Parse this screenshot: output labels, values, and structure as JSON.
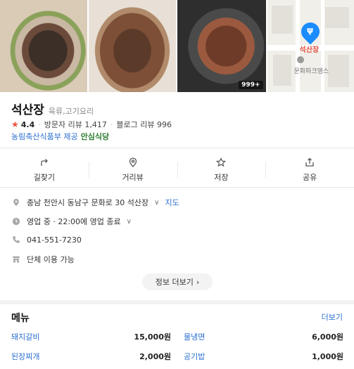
{
  "photos": {
    "count_badge": "999+",
    "map": {
      "pin_label": "석산장",
      "poi_label": "문화파크엠스"
    }
  },
  "place": {
    "name": "석산장",
    "category": "육류,고기요리",
    "rating": "4.4",
    "visitor_reviews": "방문자 리뷰 1,417",
    "blog_reviews": "블로그 리뷰 996",
    "provider": "농림축산식품부 제공",
    "provider_brand": "안심식당"
  },
  "actions": [
    {
      "label": "길찾기",
      "icon": "directions-icon"
    },
    {
      "label": "거리뷰",
      "icon": "street-view-icon"
    },
    {
      "label": "저장",
      "icon": "star-icon"
    },
    {
      "label": "공유",
      "icon": "share-icon"
    }
  ],
  "details": {
    "address": "충남 천안시 동남구 문화로 30 석산장",
    "address_map_link": "지도",
    "hours": "영업 중 · 22:00에 영업 종료",
    "phone": "041-551-7230",
    "group": "단체 이용 가능"
  },
  "more_info_label": "정보 더보기",
  "menu": {
    "title": "메뉴",
    "more_label": "더보기",
    "items": [
      {
        "name": "돼지갈비",
        "price": "15,000원"
      },
      {
        "name": "물냉면",
        "price": "6,000원"
      },
      {
        "name": "된장찌개",
        "price": "2,000원"
      },
      {
        "name": "공기밥",
        "price": "1,000원"
      }
    ]
  },
  "colors": {
    "accent_blue": "#2a6fd1",
    "star_red": "#f0553f",
    "pin_blue": "#1a8cff"
  }
}
